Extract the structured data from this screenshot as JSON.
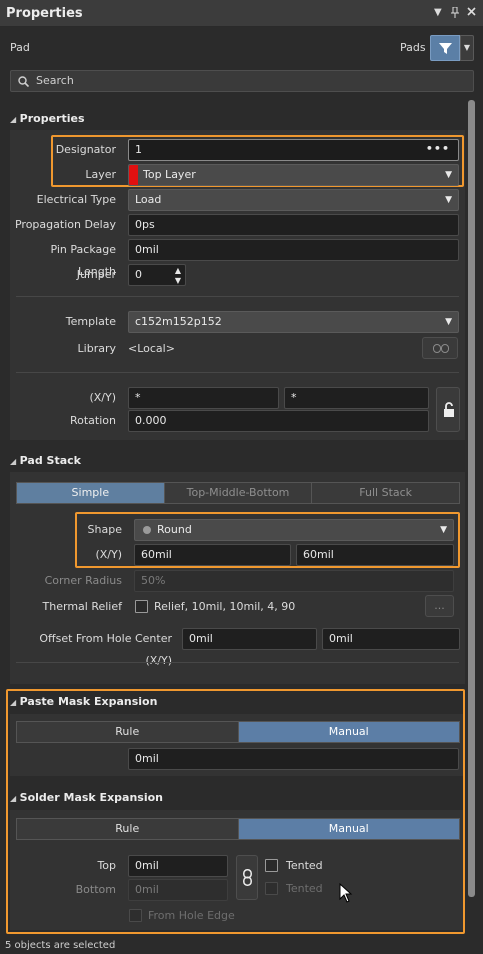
{
  "window": {
    "title": "Properties",
    "pin_icon": "pin-icon",
    "close_icon": "close-icon",
    "menu_icon": "menu-arrow-icon"
  },
  "header": {
    "object_type": "Pad",
    "filter_scope": "Pads"
  },
  "search": {
    "placeholder": "Search"
  },
  "properties": {
    "section_title": "Properties",
    "designator_label": "Designator",
    "designator_value": "1",
    "layer_label": "Layer",
    "layer_value": "Top Layer",
    "layer_color": "#e01010",
    "electrical_type_label": "Electrical Type",
    "electrical_type_value": "Load",
    "propagation_delay_label": "Propagation Delay",
    "propagation_delay_value": "0ps",
    "pin_package_length_label": "Pin Package Length",
    "pin_package_length_value": "0mil",
    "jumper_label": "Jumper",
    "jumper_value": "0",
    "template_label": "Template",
    "template_value": "c152m152p152",
    "library_label": "Library",
    "library_value": "<Local>",
    "xy_label": "(X/Y)",
    "x_value": "*",
    "y_value": "*",
    "rotation_label": "Rotation",
    "rotation_value": "0.000"
  },
  "pad_stack": {
    "section_title": "Pad Stack",
    "modes": [
      "Simple",
      "Top-Middle-Bottom",
      "Full Stack"
    ],
    "shape_label": "Shape",
    "shape_value": "Round",
    "xy_label": "(X/Y)",
    "x_value": "60mil",
    "y_value": "60mil",
    "corner_radius_label": "Corner Radius",
    "corner_radius_value": "50%",
    "thermal_relief_label": "Thermal Relief",
    "thermal_relief_value": "Relief, 10mil, 10mil, 4, 90",
    "thermal_more": "...",
    "offset_label": "Offset From Hole Center (X/Y)",
    "offset_x": "0mil",
    "offset_y": "0mil"
  },
  "paste_mask": {
    "section_title": "Paste Mask Expansion",
    "modes": [
      "Rule",
      "Manual"
    ],
    "value": "0mil"
  },
  "solder_mask": {
    "section_title": "Solder Mask Expansion",
    "modes": [
      "Rule",
      "Manual"
    ],
    "top_label": "Top",
    "top_value": "0mil",
    "bottom_label": "Bottom",
    "bottom_value": "0mil",
    "tented_label": "Tented",
    "tented_bottom_label": "Tented",
    "from_hole_edge_label": "From Hole Edge"
  },
  "status": {
    "text": "5 objects are selected"
  }
}
